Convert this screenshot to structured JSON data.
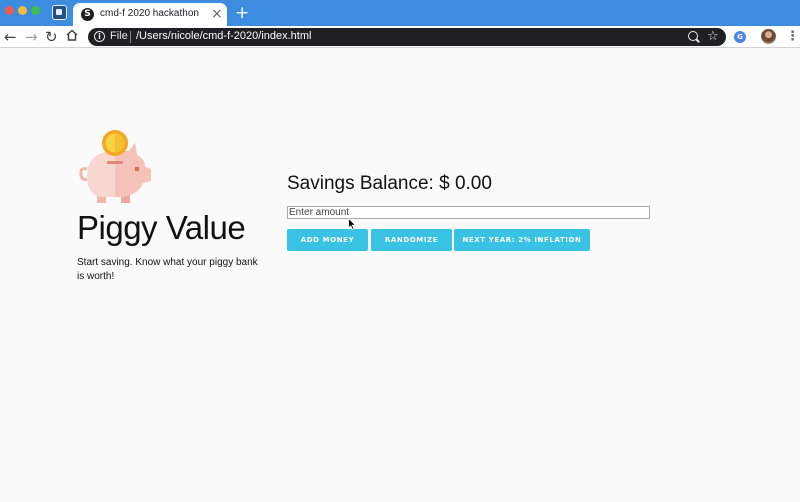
{
  "browser": {
    "tab": {
      "favicon_letter": "S",
      "title": "cmd-f 2020 hackathon",
      "close_glyph": "×"
    },
    "new_tab_glyph": "+",
    "nav": {
      "back_glyph": "←",
      "forward_glyph": "→",
      "reload_glyph": "↻"
    },
    "address": {
      "scheme": "File",
      "path": "/Users/nicole/cmd-f-2020/index.html"
    },
    "extension_letter": "G",
    "menu_glyph": "⋮",
    "star_glyph": "☆"
  },
  "app": {
    "title": "Piggy Value",
    "tagline": "Start saving. Know what your piggy bank is worth!",
    "balance_label": "Savings Balance:",
    "balance_value": "$ 0.00",
    "amount_placeholder": "Enter amount",
    "buttons": {
      "add": "ADD MONEY",
      "randomize": "RANDOMIZE",
      "next_year": "NEXT YEAR: 2% INFLATION"
    }
  },
  "colors": {
    "tab_bar": "#3c8ce0",
    "button": "#38c2e4",
    "coin": "#f7c745",
    "piggy": "#f8c9c0"
  },
  "icons": [
    "piggy-bank-coin-icon",
    "info-icon",
    "zoom-icon",
    "star-icon",
    "menu-icon",
    "home-icon"
  ]
}
